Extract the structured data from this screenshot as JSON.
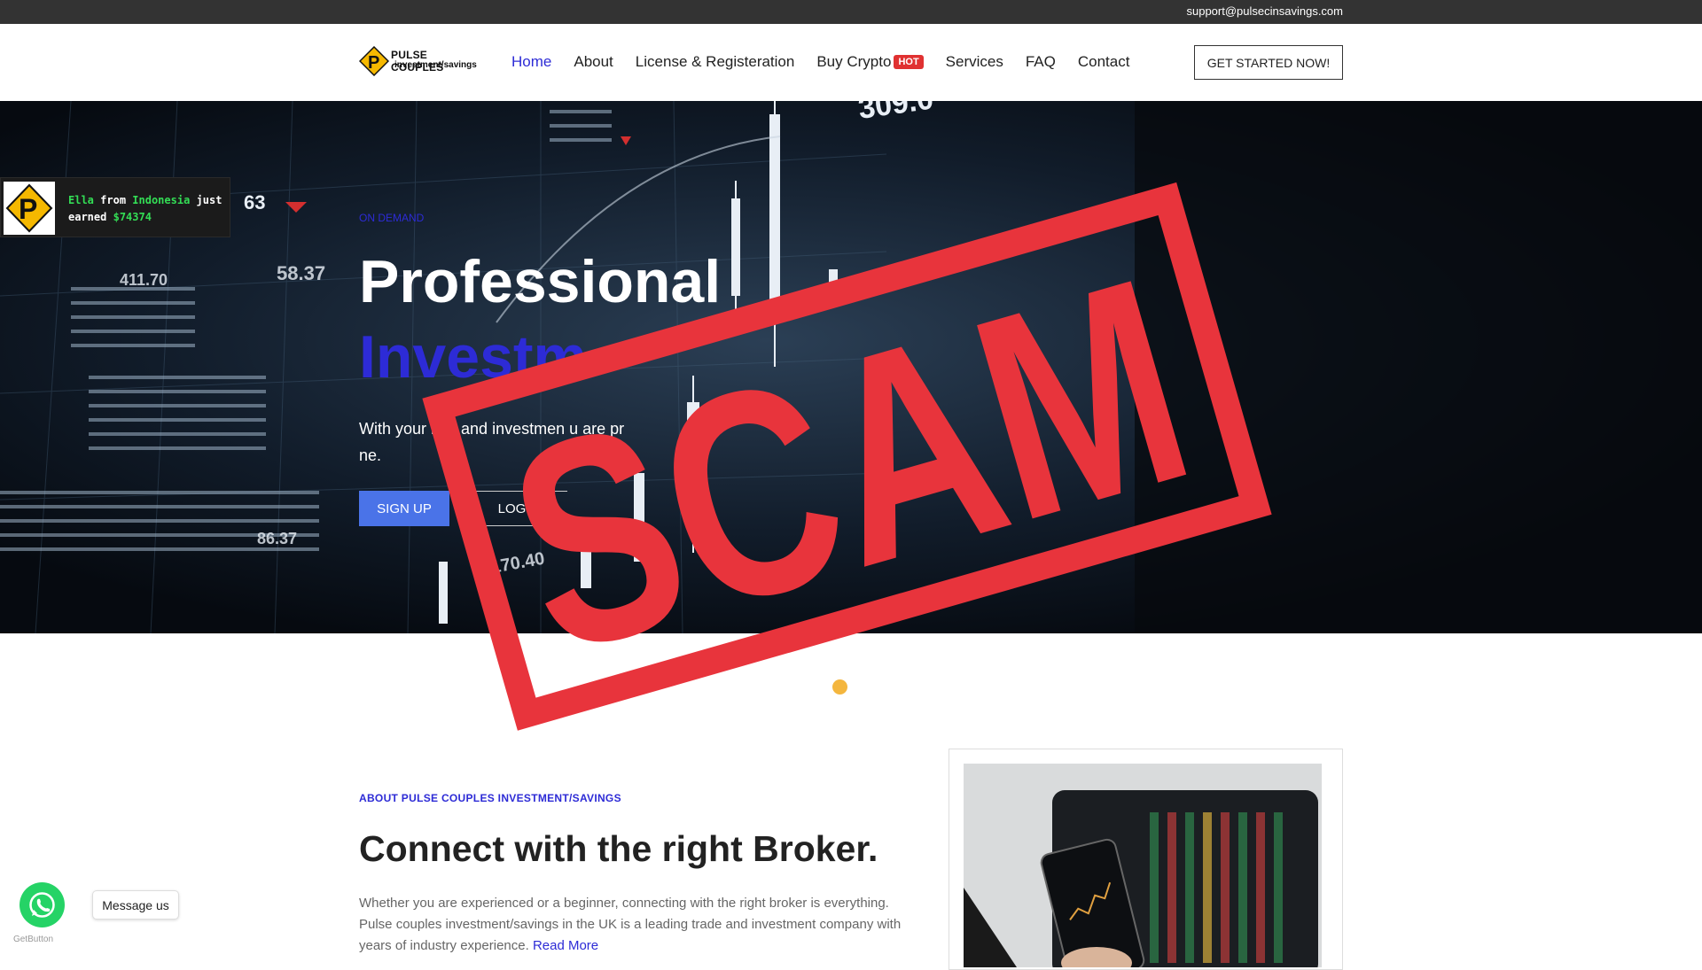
{
  "topbar": {
    "email": "support@pulsecinsavings.com"
  },
  "logo": {
    "line1": "PULSE COUPLES",
    "line2": "investment/savings",
    "icon": "pulse-couples-logo"
  },
  "nav": {
    "items": [
      {
        "label": "Home",
        "active": true
      },
      {
        "label": "About"
      },
      {
        "label": "License & Registeration"
      },
      {
        "label": "Buy Crypto",
        "badge": "HOT"
      },
      {
        "label": "Services"
      },
      {
        "label": "FAQ"
      },
      {
        "label": "Contact"
      }
    ],
    "cta": "GET STARTED NOW!"
  },
  "hero": {
    "kicker": "ON DEMAND",
    "title_line1": "Professional",
    "title_line2": "Investm",
    "subtitle": "With your  ngs and investmen  u are pr     ne.",
    "signup": "SIGN UP",
    "login": "LOGIN",
    "chart_text": [
      "309.0",
      "63",
      "58.37",
      "411.70",
      "170.40",
      "86.37"
    ]
  },
  "popup": {
    "name": "Ella",
    "from": "from",
    "country": "Indonesia",
    "just": "just",
    "earned": "earned",
    "amount": "$74374"
  },
  "stamp": {
    "text": "SCAM",
    "color": "#e8343c"
  },
  "slider": {
    "active_dot_color": "#f4b63e"
  },
  "about": {
    "kicker": "ABOUT PULSE COUPLES INVESTMENT/SAVINGS",
    "title": "Connect with the right Broker.",
    "text": "Whether you are experienced or a beginner, connecting with the right broker is everything. Pulse couples investment/savings in the UK is a leading trade and investment company with years of industry experience.",
    "read_more": "Read More"
  },
  "whatsapp": {
    "label": "Message us",
    "getbutton": "GetButton"
  },
  "colors": {
    "brand_blue": "#2d2bd6",
    "signup_blue": "#4a73e8",
    "hot_red": "#e03131"
  }
}
